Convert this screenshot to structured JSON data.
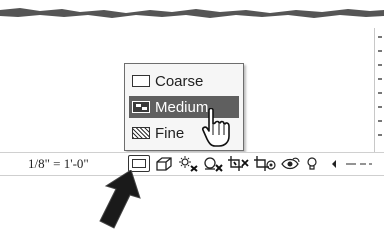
{
  "detail_level_menu": {
    "items": [
      {
        "label": "Coarse",
        "icon": "coarse-detail-icon",
        "selected": false
      },
      {
        "label": "Medium",
        "icon": "medium-detail-icon",
        "selected": true
      },
      {
        "label": "Fine",
        "icon": "fine-detail-icon",
        "selected": false
      }
    ]
  },
  "status_bar": {
    "scale": "1/8\" = 1'-0\"",
    "tools": [
      "detail-level-icon",
      "visual-style-icon",
      "sun-path-icon",
      "shadows-icon",
      "crop-view-icon",
      "show-crop-region-icon",
      "temporary-hide-icon",
      "reveal-hidden-icon",
      "scroll-left-icon"
    ]
  },
  "colors": {
    "selected_item_bg": "#5f5f5f",
    "menu_bg": "#f6f6f6",
    "menu_border": "#6e6e6e"
  }
}
